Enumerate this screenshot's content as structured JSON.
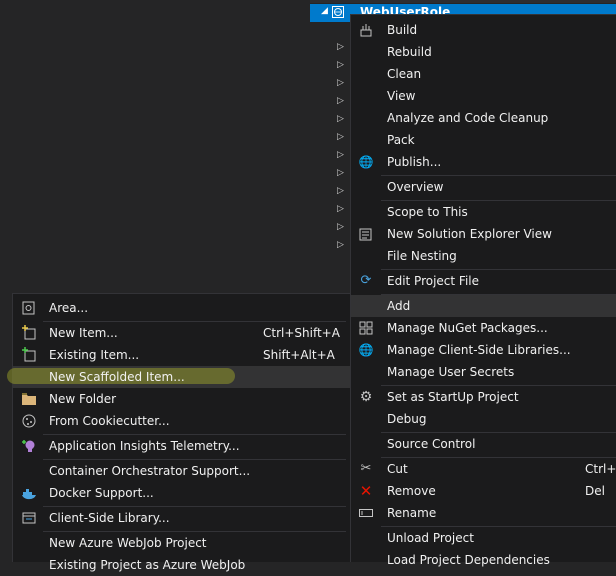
{
  "colors": {
    "selection": "#007acc",
    "menu_bg": "#1b1b1c",
    "highlight": "#333334",
    "marker": "#c8d228"
  },
  "tree": {
    "selected_project": "WebUserRole"
  },
  "context_menu": {
    "items": [
      {
        "label": "Build",
        "icon": "build-icon",
        "shortcut": ""
      },
      {
        "label": "Rebuild",
        "icon": "",
        "shortcut": ""
      },
      {
        "label": "Clean",
        "icon": "",
        "shortcut": ""
      },
      {
        "label": "View",
        "icon": "",
        "shortcut": ""
      },
      {
        "label": "Analyze and Code Cleanup",
        "icon": "",
        "shortcut": ""
      },
      {
        "label": "Pack",
        "icon": "",
        "shortcut": ""
      },
      {
        "label": "Publish...",
        "icon": "globe-icon",
        "shortcut": ""
      },
      {
        "label": "Overview",
        "icon": "",
        "shortcut": ""
      },
      {
        "label": "Scope to This",
        "icon": "",
        "shortcut": ""
      },
      {
        "label": "New Solution Explorer View",
        "icon": "new-view-icon",
        "shortcut": ""
      },
      {
        "label": "File Nesting",
        "icon": "",
        "shortcut": ""
      },
      {
        "label": "Edit Project File",
        "icon": "refresh-arrow-icon",
        "shortcut": ""
      },
      {
        "label": "Add",
        "icon": "",
        "shortcut": ""
      },
      {
        "label": "Manage NuGet Packages...",
        "icon": "nuget-icon",
        "shortcut": ""
      },
      {
        "label": "Manage Client-Side Libraries...",
        "icon": "globe-icon",
        "shortcut": ""
      },
      {
        "label": "Manage User Secrets",
        "icon": "",
        "shortcut": ""
      },
      {
        "label": "Set as StartUp Project",
        "icon": "gear-icon",
        "shortcut": ""
      },
      {
        "label": "Debug",
        "icon": "",
        "shortcut": ""
      },
      {
        "label": "Source Control",
        "icon": "",
        "shortcut": ""
      },
      {
        "label": "Cut",
        "icon": "scissors-icon",
        "shortcut": "Ctrl+X"
      },
      {
        "label": "Remove",
        "icon": "remove-x-icon",
        "shortcut": "Del"
      },
      {
        "label": "Rename",
        "icon": "rename-icon",
        "shortcut": ""
      },
      {
        "label": "Unload Project",
        "icon": "",
        "shortcut": ""
      },
      {
        "label": "Load Project Dependencies",
        "icon": "",
        "shortcut": ""
      }
    ]
  },
  "add_submenu": {
    "items": [
      {
        "label": "Area...",
        "icon": "area-icon",
        "shortcut": ""
      },
      {
        "label": "New Item...",
        "icon": "new-item-icon",
        "shortcut": "Ctrl+Shift+A"
      },
      {
        "label": "Existing Item...",
        "icon": "existing-item-icon",
        "shortcut": "Shift+Alt+A"
      },
      {
        "label": "New Scaffolded Item...",
        "icon": "",
        "shortcut": ""
      },
      {
        "label": "New Folder",
        "icon": "folder-icon",
        "shortcut": ""
      },
      {
        "label": "From Cookiecutter...",
        "icon": "cookie-icon",
        "shortcut": ""
      },
      {
        "label": "Application Insights Telemetry...",
        "icon": "insights-bulb-icon",
        "shortcut": ""
      },
      {
        "label": "Container Orchestrator Support...",
        "icon": "",
        "shortcut": ""
      },
      {
        "label": "Docker Support...",
        "icon": "docker-icon",
        "shortcut": ""
      },
      {
        "label": "Client-Side Library...",
        "icon": "library-icon",
        "shortcut": ""
      },
      {
        "label": "New Azure WebJob Project",
        "icon": "",
        "shortcut": ""
      },
      {
        "label": "Existing Project as Azure WebJob",
        "icon": "",
        "shortcut": ""
      }
    ]
  }
}
